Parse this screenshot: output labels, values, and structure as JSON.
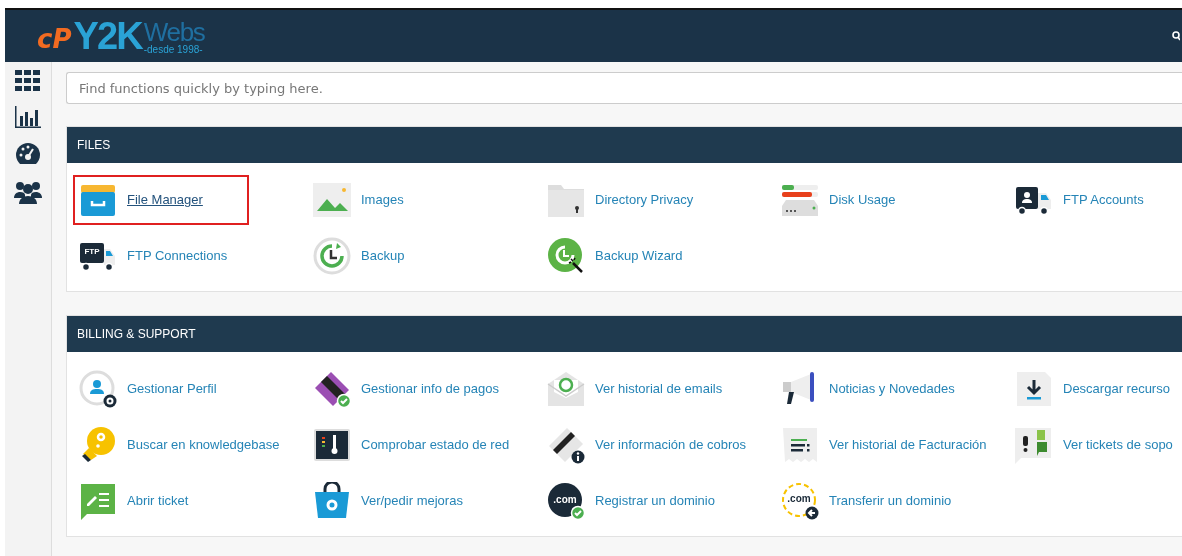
{
  "logo": {
    "mark": "cP",
    "name": "Y2K",
    "suffix": "Webs",
    "tagline": "-desde 1998-"
  },
  "search": {
    "placeholder": "Find functions quickly by typing here."
  },
  "sections": [
    {
      "title": "FILES",
      "items": [
        {
          "label": "File Manager",
          "highlighted": true
        },
        {
          "label": "Images",
          "highlighted": false
        },
        {
          "label": "Directory Privacy",
          "highlighted": false
        },
        {
          "label": "Disk Usage",
          "highlighted": false
        },
        {
          "label": "FTP Accounts",
          "highlighted": false
        },
        {
          "label": "FTP Connections",
          "highlighted": false,
          "badge": "FTP"
        },
        {
          "label": "Backup",
          "highlighted": false
        },
        {
          "label": "Backup Wizard",
          "highlighted": false
        }
      ]
    },
    {
      "title": "BILLING & SUPPORT",
      "items": [
        {
          "label": "Gestionar Perfil",
          "highlighted": false
        },
        {
          "label": "Gestionar info de pagos",
          "highlighted": false
        },
        {
          "label": "Ver historial de emails",
          "highlighted": false
        },
        {
          "label": "Noticias y Novedades",
          "highlighted": false
        },
        {
          "label": "Descargar recurso",
          "highlighted": false
        },
        {
          "label": "Buscar en knowledgebase",
          "highlighted": false
        },
        {
          "label": "Comprobar estado de red",
          "highlighted": false
        },
        {
          "label": "Ver información de cobros",
          "highlighted": false
        },
        {
          "label": "Ver historial de Facturación",
          "highlighted": false
        },
        {
          "label": "Ver tickets de sopo",
          "highlighted": false
        },
        {
          "label": "Abrir ticket",
          "highlighted": false
        },
        {
          "label": "Ver/pedir mejoras",
          "highlighted": false
        },
        {
          "label": "Registrar un dominio",
          "highlighted": false,
          "badge": ".com"
        },
        {
          "label": "Transferir un dominio",
          "highlighted": false,
          "badge": ".com"
        }
      ]
    }
  ]
}
